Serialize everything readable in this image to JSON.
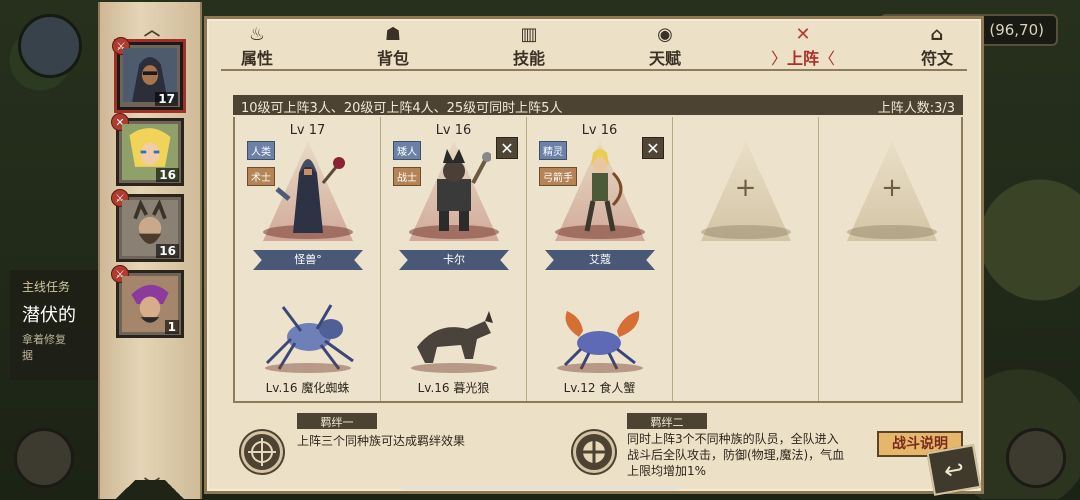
{
  "hud": {
    "coords": "(96,70)",
    "quest": {
      "title": "主线任务",
      "name": "潜伏的",
      "sub1": "拿着修复",
      "sub2": "据"
    }
  },
  "heroes": [
    {
      "level": "17"
    },
    {
      "level": "16"
    },
    {
      "level": "16"
    },
    {
      "level": "1"
    }
  ],
  "tabs": [
    {
      "label": "属性",
      "icon": "scroll-icon"
    },
    {
      "label": "背包",
      "icon": "bag-icon"
    },
    {
      "label": "技能",
      "icon": "book-icon"
    },
    {
      "label": "天赋",
      "icon": "eye-icon"
    },
    {
      "label": "上阵",
      "icon": "crossed-swords-icon"
    },
    {
      "label": "符文",
      "icon": "rune-icon"
    }
  ],
  "lineup": {
    "rule_text": "10级可上阵3人、20级可上阵4人、25级可同时上阵5人",
    "count_text": "上阵人数:3/3",
    "slots": [
      {
        "level": "Lv 17",
        "race": "人类",
        "class": "术士",
        "name": "怪兽°",
        "pet": "Lv.16 魔化蜘蛛"
      },
      {
        "level": "Lv 16",
        "race": "矮人",
        "class": "战士",
        "name": "卡尔",
        "pet": "Lv.16 暮光狼"
      },
      {
        "level": "Lv 16",
        "race": "精灵",
        "class": "弓箭手",
        "name": "艾蔻",
        "pet": "Lv.12 食人蟹"
      }
    ],
    "empty_plus": "+",
    "remove_glyph": "✕"
  },
  "bonds": {
    "bond1": {
      "title": "羁绊一",
      "text": "上阵三个同种族可达成羁绊效果"
    },
    "bond2": {
      "title": "羁绊二",
      "line1": "同时上阵3个不同种族的队员，全队进入",
      "line2": "战斗后全队攻击，防御(物理,魔法)，气血",
      "line3": "上限均增加1%"
    },
    "explain_label": "战斗说明"
  }
}
